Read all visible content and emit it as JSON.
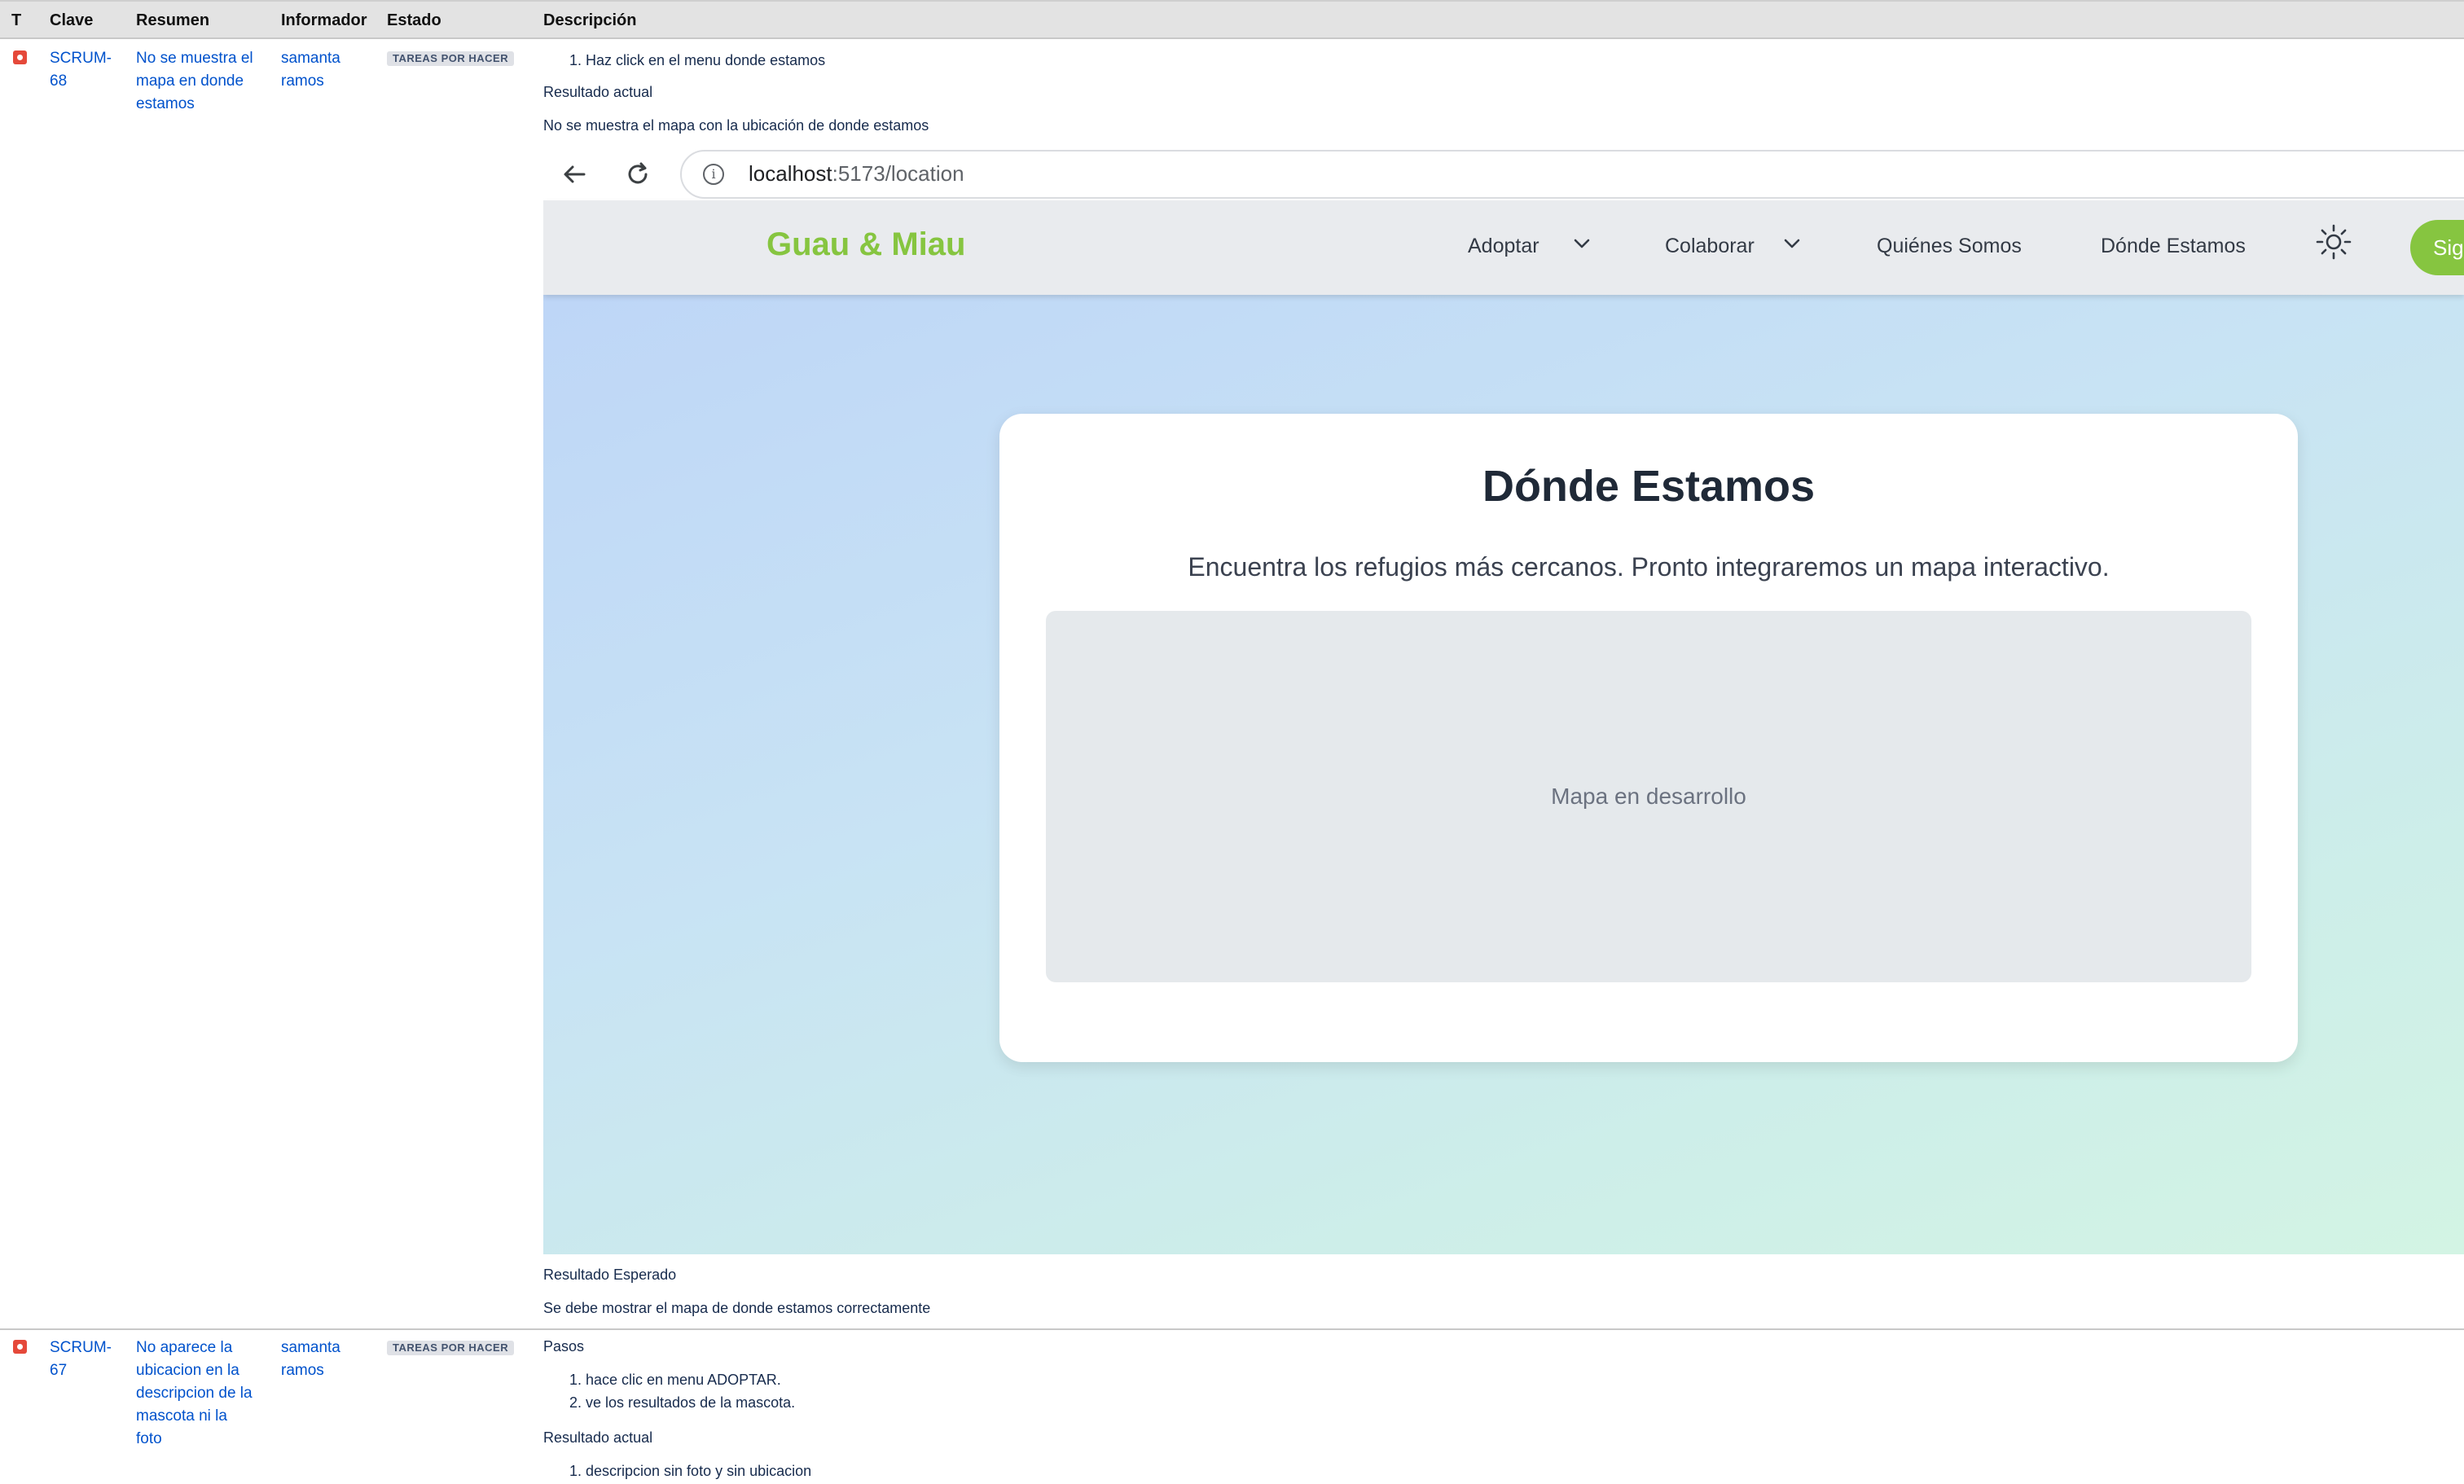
{
  "table": {
    "headers": {
      "type": "T",
      "key": "Clave",
      "summary": "Resumen",
      "reporter": "Informador",
      "status": "Estado",
      "description": "Descripción"
    }
  },
  "issues": [
    {
      "type_icon": "bug-icon",
      "key_line1": "SCRUM-",
      "key_line2": "68",
      "summary_lines": [
        "No se muestra el",
        "mapa en donde",
        "estamos"
      ],
      "reporter_lines": [
        "samanta",
        "ramos"
      ],
      "status": "TAREAS POR HACER",
      "steps": [
        "Haz click en el menu donde estamos"
      ],
      "actual_label": "Resultado actual",
      "actual_text": "No se muestra el mapa con la ubicación de donde estamos",
      "expected_label": "Resultado Esperado",
      "expected_text": "Se debe mostrar el mapa de donde estamos correctamente"
    },
    {
      "type_icon": "bug-icon",
      "key_line1": "SCRUM-",
      "key_line2": "67",
      "summary_lines": [
        "No aparece la",
        "ubicacion en la",
        "descripcion de la",
        "mascota ni la",
        "foto"
      ],
      "reporter_lines": [
        "samanta",
        "ramos"
      ],
      "status": "TAREAS POR HACER",
      "steps_label": "Pasos",
      "steps": [
        "hace clic en menu ADOPTAR.",
        "ve los resultados de la mascota."
      ],
      "actual_label": "Resultado actual",
      "actual_steps": [
        "descripcion sin foto y sin ubicacion"
      ]
    }
  ],
  "screenshot": {
    "browser": {
      "url_host": "localhost",
      "url_path": ":5173/location",
      "back_icon": "arrow-left-icon",
      "reload_icon": "reload-icon",
      "info_icon": "info-icon"
    },
    "app": {
      "logo": "Guau & Miau",
      "nav": {
        "adoptar": "Adoptar",
        "colaborar": "Colaborar",
        "quienes": "Quiénes Somos",
        "donde": "Dónde Estamos"
      },
      "theme_icon": "sun-icon",
      "signup_partial": "Sig",
      "accent_color": "#86c540"
    },
    "page": {
      "title": "Dónde Estamos",
      "subtitle": "Encuentra los refugios más cercanos. Pronto integraremos un mapa interactivo.",
      "map_placeholder": "Mapa en desarrollo"
    }
  }
}
